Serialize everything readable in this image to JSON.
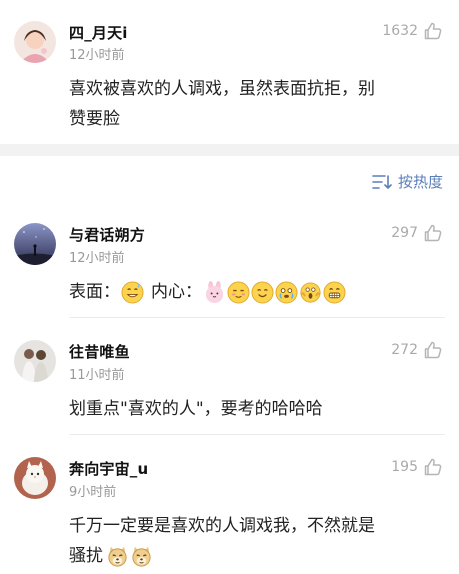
{
  "comments": [
    {
      "username": "四_月天i",
      "time": "12小时前",
      "likes": "1632",
      "text_lines": [
        "喜欢被喜欢的人调戏，虽然表面抗拒，别",
        "赞要脸"
      ]
    },
    {
      "username": "与君话朔方",
      "time": "12小时前",
      "likes": "297",
      "text_a": "表面：",
      "text_b": "内心：",
      "emojis": [
        "grinning-sweat-emoji",
        "bunny-face-emoji",
        "blushing-emoji",
        "smile-emoji",
        "tearful-emoji",
        "screaming-emoji",
        "grin-teeth-emoji"
      ]
    },
    {
      "username": "往昔唯鱼",
      "time": "11小时前",
      "likes": "272",
      "text_lines": [
        "划重点\"喜欢的人\"，要考的哈哈哈"
      ]
    },
    {
      "username": "奔向宇宙_u",
      "time": "9小时前",
      "likes": "195",
      "text_lines": [
        "千万一定要是喜欢的人调戏我，不然就是",
        "骚扰"
      ],
      "emojis": [
        "doge-emoji",
        "doge-emoji"
      ]
    }
  ],
  "sort_label": "按热度",
  "colors": {
    "accent": "#5b7fb8",
    "muted": "#999999",
    "band": "#f2f2f2"
  }
}
